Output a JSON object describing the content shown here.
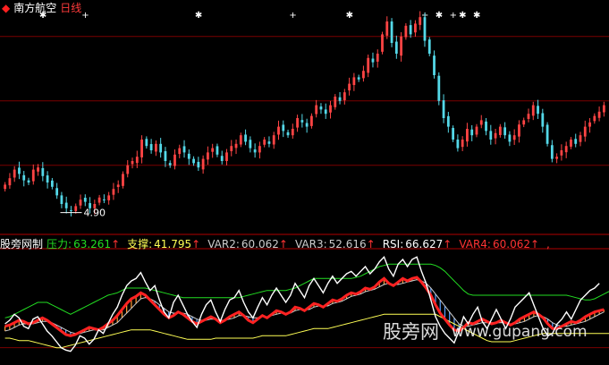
{
  "header": {
    "logo_icon": "red-diamond-icon",
    "stock_name": "南方航空",
    "period": "日线",
    "colors": {
      "stock_name": "#ffffff",
      "period": "#ff3b3b"
    }
  },
  "price_panel": {
    "low_label": "4.90",
    "signal_markers": [
      "✱",
      "+",
      "✱",
      "+",
      "✱",
      "+",
      "✱",
      "+",
      "✱",
      "✱"
    ]
  },
  "indicator": {
    "name": "股旁网制",
    "items": [
      {
        "label": "压力:",
        "value": "63.261",
        "arrow": "↑",
        "color": "#22dd22"
      },
      {
        "label": "支撑:",
        "value": "41.795",
        "arrow": "↑",
        "color": "#ffff55"
      },
      {
        "label": "VAR2:",
        "value": "60.062",
        "arrow": "↑",
        "color": "#cccccc"
      },
      {
        "label": "VAR3:",
        "value": "52.616",
        "arrow": "↑",
        "color": "#cccccc"
      },
      {
        "label": "RSI:",
        "value": "66.627",
        "arrow": "↑",
        "color": "#ffffff"
      },
      {
        "label": "VAR4:",
        "value": "60.062",
        "arrow": "↑",
        "color": "#ff3333"
      }
    ],
    "trailing": ","
  },
  "watermark": {
    "text_cn": "股旁网",
    "text_url": "www.gupang.com"
  },
  "chart_data": [
    {
      "type": "candlestick",
      "title": "南方航空 日线",
      "ylim": [
        4.6,
        9.6
      ],
      "annotations": [
        "4.90"
      ],
      "colors": {
        "up": "#ff4444",
        "down": "#54d8e8",
        "grid": "#7a0000"
      },
      "close": [
        5.55,
        5.7,
        5.9,
        5.8,
        5.65,
        5.6,
        5.9,
        5.95,
        5.75,
        5.6,
        5.5,
        5.3,
        5.1,
        5.0,
        4.95,
        5.05,
        5.2,
        5.15,
        5.0,
        5.1,
        5.25,
        5.2,
        5.3,
        5.45,
        5.55,
        5.8,
        6.0,
        6.1,
        6.2,
        6.6,
        6.45,
        6.35,
        6.5,
        6.3,
        6.1,
        6.0,
        6.25,
        6.4,
        6.3,
        6.15,
        6.05,
        5.95,
        6.15,
        6.3,
        6.4,
        6.25,
        6.1,
        6.3,
        6.45,
        6.5,
        6.7,
        6.55,
        6.4,
        6.3,
        6.45,
        6.6,
        6.5,
        6.7,
        6.9,
        6.8,
        6.7,
        6.85,
        7.1,
        7.0,
        6.9,
        7.15,
        7.4,
        7.3,
        7.2,
        7.4,
        7.6,
        7.5,
        7.7,
        7.9,
        8.05,
        8.0,
        8.2,
        8.5,
        8.4,
        8.6,
        9.05,
        9.35,
        8.85,
        8.6,
        9.0,
        9.25,
        9.05,
        9.3,
        9.45,
        8.9,
        8.6,
        8.1,
        7.5,
        7.1,
        6.9,
        6.6,
        6.4,
        6.6,
        6.85,
        6.7,
        6.9,
        7.05,
        6.8,
        6.6,
        6.75,
        6.9,
        6.7,
        6.55,
        6.7,
        6.95,
        7.05,
        7.2,
        7.4,
        7.2,
        6.9,
        6.5,
        6.15,
        6.2,
        6.35,
        6.45,
        6.6,
        6.5,
        6.7,
        6.9,
        7.0,
        7.15,
        7.25,
        7.4
      ]
    },
    {
      "type": "line",
      "title": "股旁网制",
      "series": [
        {
          "name": "压力",
          "values": [
            55,
            56,
            58,
            60,
            62,
            64,
            66,
            68,
            68,
            68,
            66,
            64,
            62,
            60,
            58,
            60,
            62,
            64,
            66,
            68,
            70,
            72,
            74,
            75,
            76,
            78,
            80,
            80,
            80,
            80,
            80,
            79,
            78,
            77,
            76,
            75,
            74,
            73,
            72,
            72,
            72,
            72,
            72,
            72,
            72,
            72,
            72,
            72,
            72,
            72,
            72,
            73,
            74,
            75,
            76,
            77,
            78,
            78,
            78,
            78,
            78,
            79,
            80,
            82,
            84,
            86,
            88,
            88,
            88,
            88,
            88,
            88,
            88,
            88,
            88,
            89,
            90,
            92,
            94,
            96,
            98,
            99,
            100,
            100,
            100,
            100,
            100,
            100,
            100,
            100,
            100,
            100,
            99,
            97,
            94,
            90,
            86,
            82,
            78,
            75,
            74,
            74,
            74,
            74,
            74,
            74,
            74,
            74,
            74,
            74,
            74,
            74,
            74,
            74,
            74,
            74,
            74,
            74,
            74,
            74,
            74,
            73,
            72,
            71,
            70,
            70,
            71,
            73,
            75,
            77,
            79
          ]
        },
        {
          "name": "支撑",
          "values": [
            38,
            38,
            37,
            36,
            36,
            36,
            35,
            34,
            33,
            32,
            31,
            30,
            30,
            31,
            32,
            33,
            34,
            35,
            36,
            37,
            38,
            39,
            40,
            41,
            42,
            43,
            44,
            45,
            45,
            45,
            45,
            45,
            44,
            43,
            42,
            41,
            40,
            39,
            38,
            37,
            37,
            37,
            37,
            37,
            37,
            38,
            38,
            38,
            38,
            38,
            38,
            38,
            38,
            38,
            39,
            40,
            40,
            40,
            40,
            40,
            40,
            41,
            42,
            43,
            44,
            45,
            46,
            46,
            46,
            46,
            47,
            48,
            49,
            50,
            51,
            52,
            53,
            54,
            55,
            56,
            57,
            58,
            58,
            58,
            58,
            58,
            58,
            58,
            58,
            58,
            58,
            58,
            58,
            56,
            54,
            52,
            50,
            48,
            46,
            44,
            42,
            40,
            38,
            36,
            35,
            35,
            35,
            35,
            35,
            36,
            37,
            38,
            39,
            40,
            41,
            42,
            42,
            42,
            42,
            42,
            42,
            42,
            42,
            42,
            42,
            42,
            42,
            42,
            42,
            42,
            42
          ]
        },
        {
          "name": "VAR2",
          "values": [
            48,
            49,
            51,
            53,
            52,
            50,
            51,
            53,
            55,
            53,
            50,
            47,
            44,
            41,
            40,
            41,
            43,
            45,
            47,
            46,
            45,
            47,
            50,
            53,
            57,
            62,
            67,
            71,
            73,
            76,
            74,
            70,
            66,
            62,
            58,
            55,
            57,
            60,
            58,
            55,
            52,
            50,
            52,
            54,
            56,
            54,
            51,
            53,
            56,
            58,
            60,
            57,
            53,
            51,
            54,
            57,
            55,
            58,
            61,
            60,
            58,
            60,
            64,
            63,
            61,
            64,
            67,
            66,
            64,
            67,
            70,
            69,
            71,
            74,
            76,
            75,
            77,
            80,
            79,
            81,
            85,
            88,
            84,
            82,
            85,
            88,
            86,
            88,
            89,
            85,
            80,
            74,
            66,
            59,
            54,
            49,
            45,
            44,
            47,
            51,
            50,
            52,
            54,
            52,
            50,
            51,
            53,
            51,
            49,
            51,
            54,
            56,
            58,
            60,
            58,
            55,
            50,
            46,
            46,
            48,
            50,
            52,
            51,
            53,
            56,
            58,
            60,
            61,
            62
          ]
        },
        {
          "name": "VAR3",
          "values": [
            44,
            45,
            47,
            49,
            50,
            50,
            50,
            51,
            52,
            52,
            51,
            49,
            47,
            45,
            43,
            42,
            42,
            43,
            44,
            45,
            45,
            45,
            47,
            49,
            51,
            55,
            59,
            63,
            67,
            71,
            72,
            71,
            69,
            66,
            63,
            60,
            59,
            59,
            59,
            58,
            56,
            54,
            53,
            53,
            54,
            54,
            53,
            53,
            54,
            55,
            57,
            57,
            56,
            55,
            55,
            56,
            56,
            57,
            58,
            59,
            59,
            59,
            61,
            62,
            62,
            62,
            64,
            65,
            65,
            65,
            67,
            68,
            69,
            71,
            73,
            74,
            75,
            77,
            78,
            79,
            81,
            83,
            84,
            83,
            83,
            84,
            85,
            86,
            87,
            86,
            84,
            80,
            75,
            70,
            65,
            60,
            55,
            50,
            48,
            48,
            49,
            50,
            51,
            51,
            51,
            51,
            51,
            51,
            50,
            50,
            51,
            52,
            54,
            56,
            57,
            56,
            54,
            51,
            49,
            48,
            48,
            49,
            50,
            51,
            52,
            54,
            56,
            58,
            60
          ]
        },
        {
          "name": "RSI",
          "values": [
            50,
            53,
            58,
            55,
            48,
            46,
            54,
            56,
            50,
            44,
            40,
            35,
            30,
            28,
            27,
            32,
            40,
            38,
            33,
            37,
            45,
            42,
            50,
            58,
            64,
            74,
            82,
            86,
            88,
            93,
            85,
            78,
            82,
            70,
            60,
            55,
            68,
            74,
            66,
            58,
            52,
            47,
            58,
            66,
            70,
            60,
            52,
            62,
            70,
            72,
            78,
            68,
            60,
            55,
            64,
            72,
            66,
            74,
            80,
            74,
            68,
            74,
            84,
            78,
            72,
            82,
            88,
            82,
            76,
            84,
            90,
            84,
            88,
            92,
            94,
            90,
            94,
            98,
            92,
            96,
            102,
            106,
            96,
            90,
            100,
            104,
            98,
            104,
            106,
            94,
            84,
            70,
            56,
            48,
            42,
            38,
            34,
            44,
            56,
            50,
            58,
            64,
            52,
            46,
            54,
            62,
            54,
            46,
            54,
            64,
            68,
            72,
            76,
            66,
            56,
            46,
            40,
            42,
            50,
            54,
            60,
            54,
            62,
            70,
            74,
            78,
            80,
            84
          ]
        },
        {
          "name": "VAR4",
          "values": [
            48,
            49,
            51,
            53,
            52,
            50,
            51,
            53,
            55,
            53,
            50,
            47,
            44,
            41,
            40,
            41,
            43,
            45,
            47,
            46,
            45,
            47,
            50,
            53,
            57,
            62,
            67,
            71,
            73,
            76,
            74,
            70,
            66,
            62,
            58,
            55,
            57,
            60,
            58,
            55,
            52,
            50,
            52,
            54,
            56,
            54,
            51,
            53,
            56,
            58,
            60,
            57,
            53,
            51,
            54,
            57,
            55,
            58,
            61,
            60,
            58,
            60,
            64,
            63,
            61,
            64,
            67,
            66,
            64,
            67,
            70,
            69,
            71,
            74,
            76,
            75,
            77,
            80,
            79,
            81,
            85,
            88,
            84,
            82,
            85,
            88,
            86,
            88,
            89,
            85,
            80,
            74,
            66,
            59,
            54,
            49,
            45,
            44,
            47,
            51,
            50,
            52,
            54,
            52,
            50,
            51,
            53,
            51,
            49,
            51,
            54,
            56,
            58,
            60,
            58,
            55,
            50,
            46,
            46,
            48,
            50,
            52,
            51,
            53,
            56,
            58,
            60,
            61,
            62
          ]
        }
      ]
    }
  ]
}
